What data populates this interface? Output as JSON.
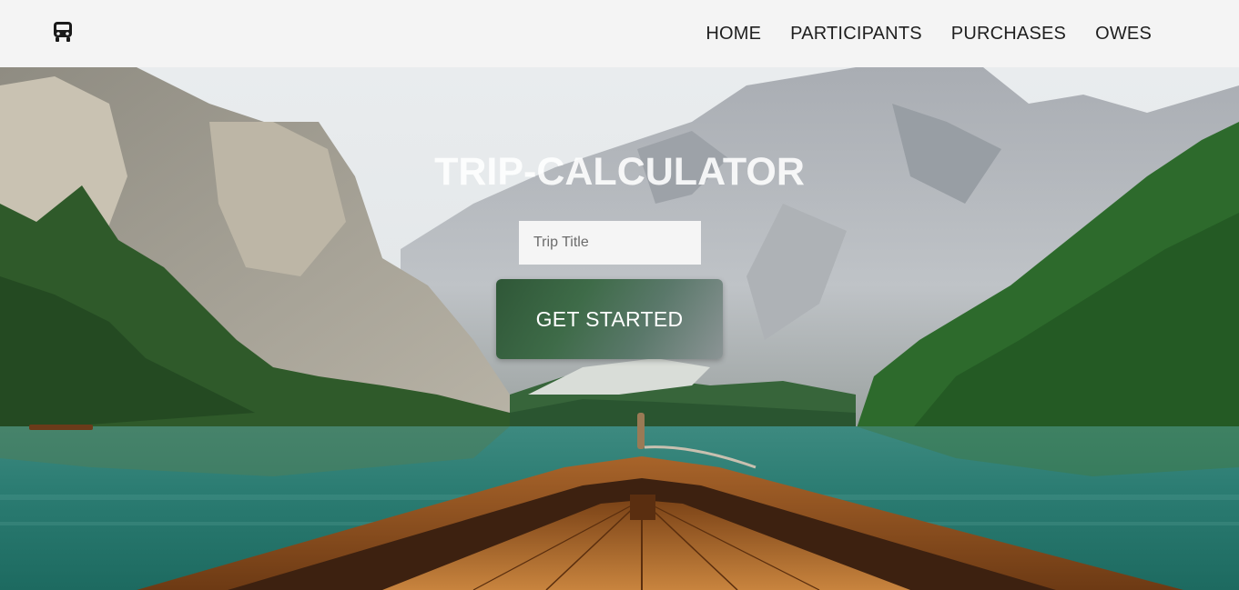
{
  "app": {
    "logo_icon": "bus-icon"
  },
  "nav": {
    "items": [
      {
        "label": "HOME"
      },
      {
        "label": "PARTICIPANTS"
      },
      {
        "label": "PURCHASES"
      },
      {
        "label": "OWES"
      }
    ]
  },
  "hero": {
    "title": "TRIP-CALCULATOR",
    "trip_input": {
      "placeholder": "Trip Title",
      "value": ""
    },
    "cta_label": "GET STARTED",
    "background": "mountain-lake-boat-photo"
  },
  "colors": {
    "navbar_bg": "#f4f4f4",
    "nav_text": "#1f1f1f",
    "cta_start": "#2f5737",
    "cta_end": "#8b9495"
  }
}
